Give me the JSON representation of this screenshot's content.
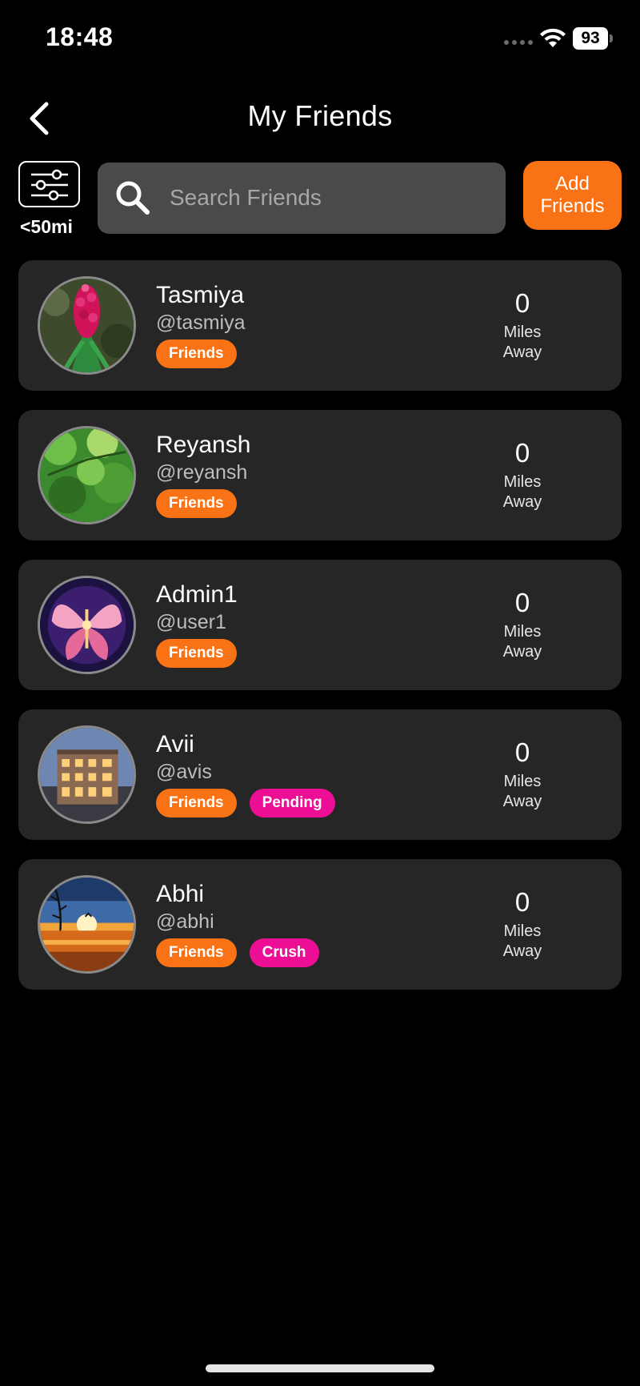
{
  "status_bar": {
    "time": "18:48",
    "battery": "93"
  },
  "header": {
    "title": "My Friends"
  },
  "filter": {
    "distance_label": "<50mi"
  },
  "search": {
    "placeholder": "Search Friends"
  },
  "add_friends_label": "Add\nFriends",
  "friends": [
    {
      "name": "Tasmiya",
      "handle": "@tasmiya",
      "badges": [
        "Friends"
      ],
      "distance": "0",
      "distance_unit_1": "Miles",
      "distance_unit_2": "Away",
      "avatar": "flower"
    },
    {
      "name": "Reyansh",
      "handle": "@reyansh",
      "badges": [
        "Friends"
      ],
      "distance": "0",
      "distance_unit_1": "Miles",
      "distance_unit_2": "Away",
      "avatar": "leaves"
    },
    {
      "name": "Admin1",
      "handle": "@user1",
      "badges": [
        "Friends"
      ],
      "distance": "0",
      "distance_unit_1": "Miles",
      "distance_unit_2": "Away",
      "avatar": "butterfly"
    },
    {
      "name": "Avii",
      "handle": "@avis",
      "badges": [
        "Friends",
        "Pending"
      ],
      "distance": "0",
      "distance_unit_1": "Miles",
      "distance_unit_2": "Away",
      "avatar": "building"
    },
    {
      "name": "Abhi",
      "handle": "@abhi",
      "badges": [
        "Friends",
        "Crush"
      ],
      "distance": "0",
      "distance_unit_1": "Miles",
      "distance_unit_2": "Away",
      "avatar": "sunset"
    }
  ],
  "colors": {
    "accent": "#f97316",
    "pink": "#ec0f95",
    "card": "#262626",
    "search_bg": "#4a4a4a"
  }
}
